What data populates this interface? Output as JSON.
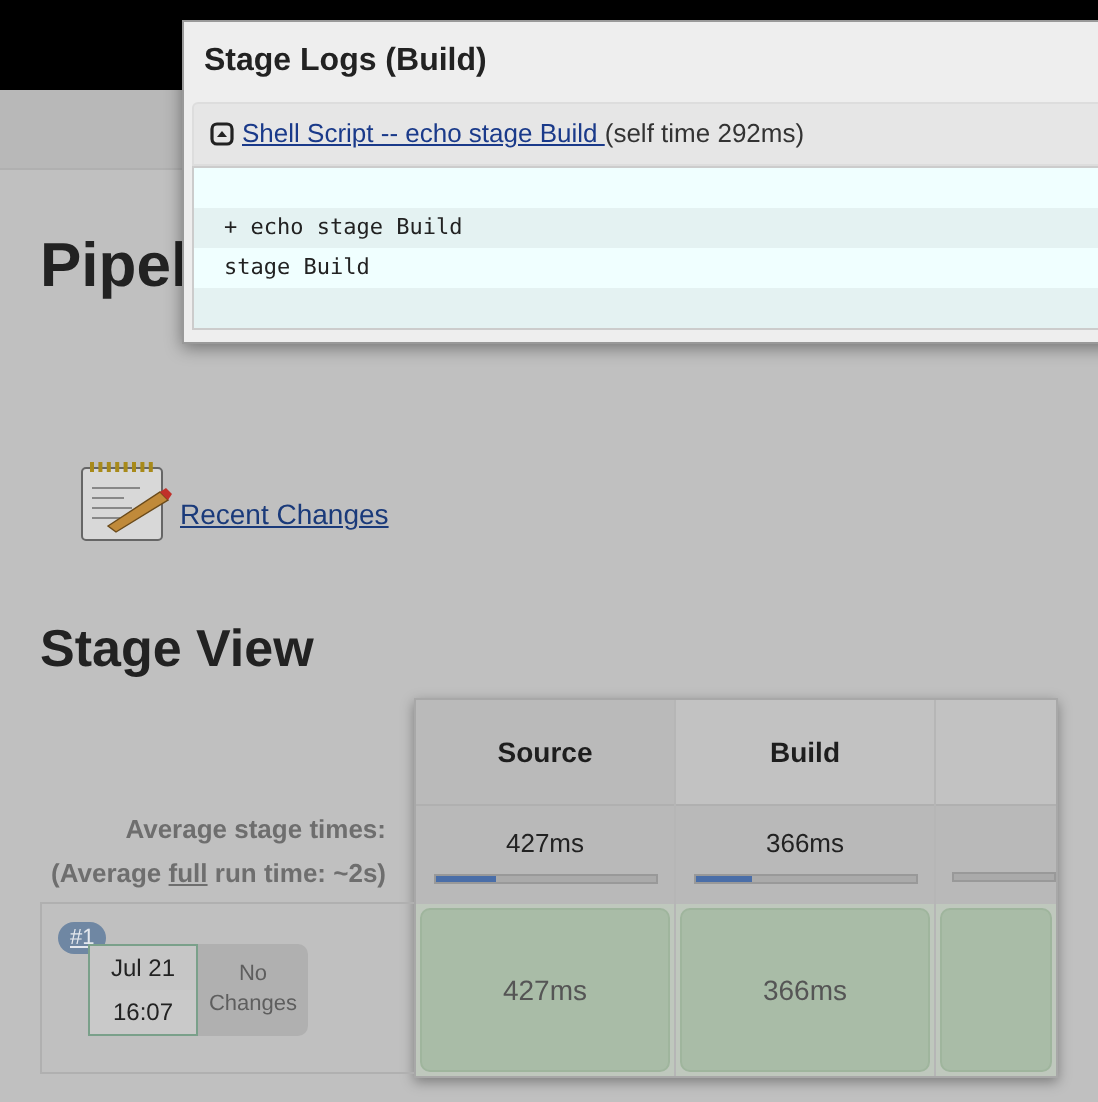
{
  "page_title": "Pipel",
  "recent_changes": {
    "label": "Recent Changes"
  },
  "stage_view": {
    "title": "Stage View",
    "avg_label": "Average stage times:",
    "avg_full": "(Average **full** run time: ~2s)",
    "stages": [
      {
        "name": "Source",
        "avg": "427ms",
        "level": 0.28
      },
      {
        "name": "Build",
        "avg": "366ms",
        "level": 0.26
      }
    ],
    "runs": [
      {
        "number": "#1",
        "date": "Jul 21",
        "time": "16:07",
        "changes": "No Changes",
        "cells": [
          {
            "time": "427ms"
          },
          {
            "time": "366ms"
          }
        ]
      }
    ]
  },
  "dialog": {
    "title": "Stage Logs (Build)",
    "step": {
      "link": "Shell Script -- echo stage Build ",
      "self_time": "(self time 292ms)",
      "expanded": true
    },
    "log_lines": [
      "+ echo stage Build",
      "stage Build"
    ]
  }
}
